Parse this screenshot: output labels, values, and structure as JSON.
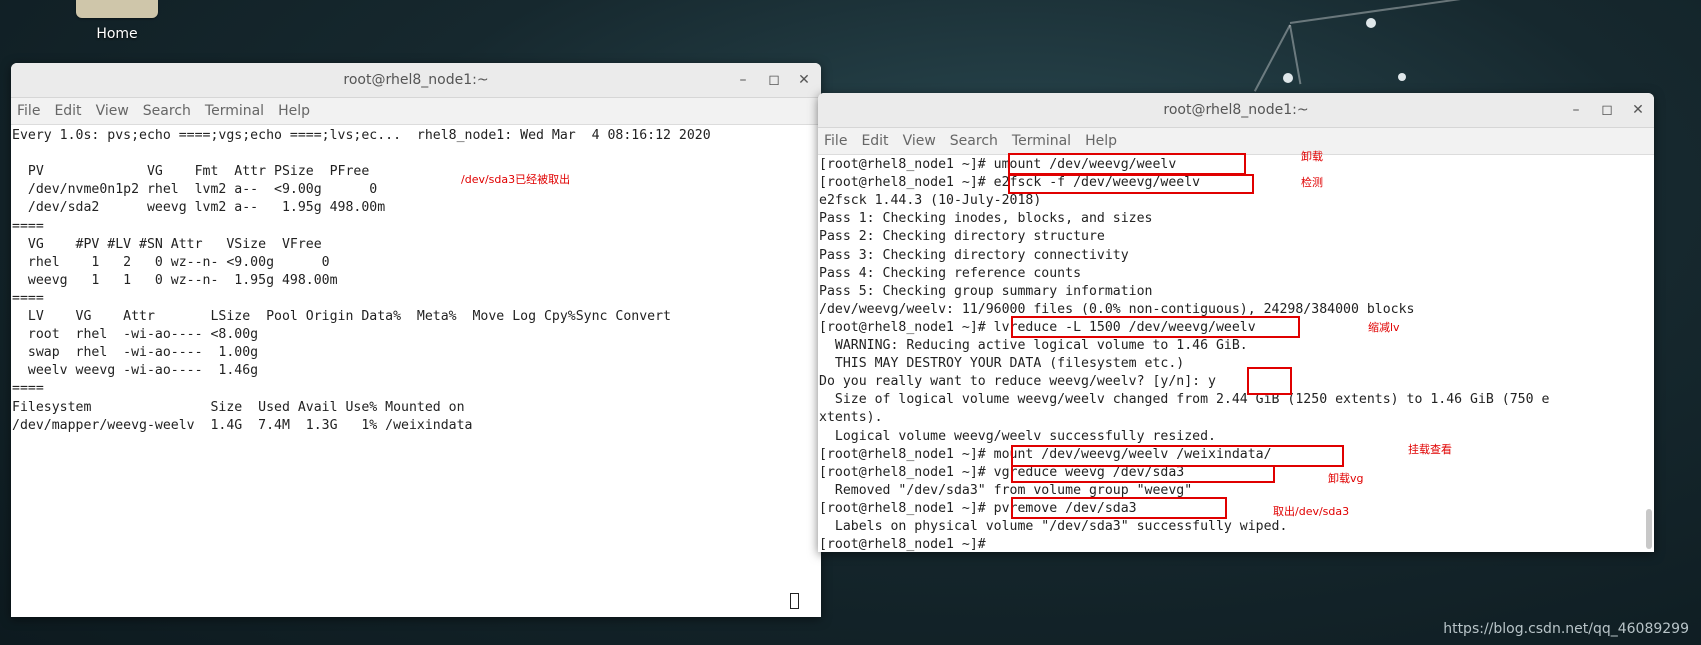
{
  "desktop": {
    "home_label": "Home",
    "watermark": "https://blog.csdn.net/qq_46089299"
  },
  "left_terminal": {
    "title": "root@rhel8_node1:~",
    "menu": [
      "File",
      "Edit",
      "View",
      "Search",
      "Terminal",
      "Help"
    ],
    "lines": [
      "Every 1.0s: pvs;echo ====;vgs;echo ====;lvs;ec...  rhel8_node1: Wed Mar  4 08:16:12 2020",
      "",
      "  PV             VG    Fmt  Attr PSize  PFree",
      "  /dev/nvme0n1p2 rhel  lvm2 a--  <9.00g      0",
      "  /dev/sda2      weevg lvm2 a--   1.95g 498.00m",
      "====",
      "  VG    #PV #LV #SN Attr   VSize  VFree",
      "  rhel    1   2   0 wz--n- <9.00g      0",
      "  weevg   1   1   0 wz--n-  1.95g 498.00m",
      "====",
      "  LV    VG    Attr       LSize  Pool Origin Data%  Meta%  Move Log Cpy%Sync Convert",
      "  root  rhel  -wi-ao---- <8.00g",
      "  swap  rhel  -wi-ao----  1.00g",
      "  weelv weevg -wi-ao----  1.46g",
      "====",
      "Filesystem               Size  Used Avail Use% Mounted on",
      "/dev/mapper/weevg-weelv  1.4G  7.4M  1.3G   1% /weixindata"
    ],
    "annotation": "/dev/sda3已经被取出"
  },
  "right_terminal": {
    "title": "root@rhel8_node1:~",
    "menu": [
      "File",
      "Edit",
      "View",
      "Search",
      "Terminal",
      "Help"
    ],
    "lines": [
      "[root@rhel8_node1 ~]# umount /dev/weevg/weelv",
      "[root@rhel8_node1 ~]# e2fsck -f /dev/weevg/weelv",
      "e2fsck 1.44.3 (10-July-2018)",
      "Pass 1: Checking inodes, blocks, and sizes",
      "Pass 2: Checking directory structure",
      "Pass 3: Checking directory connectivity",
      "Pass 4: Checking reference counts",
      "Pass 5: Checking group summary information",
      "/dev/weevg/weelv: 11/96000 files (0.0% non-contiguous), 24298/384000 blocks",
      "[root@rhel8_node1 ~]# lvreduce -L 1500 /dev/weevg/weelv",
      "  WARNING: Reducing active logical volume to 1.46 GiB.",
      "  THIS MAY DESTROY YOUR DATA (filesystem etc.)",
      "Do you really want to reduce weevg/weelv? [y/n]: y",
      "  Size of logical volume weevg/weelv changed from 2.44 GiB (1250 extents) to 1.46 GiB (750 e",
      "xtents).",
      "  Logical volume weevg/weelv successfully resized.",
      "[root@rhel8_node1 ~]# mount /dev/weevg/weelv /weixindata/",
      "[root@rhel8_node1 ~]# vgreduce weevg /dev/sda3",
      "  Removed \"/dev/sda3\" from volume group \"weevg\"",
      "[root@rhel8_node1 ~]# pvremove /dev/sda3",
      "  Labels on physical volume \"/dev/sda3\" successfully wiped.",
      "[root@rhel8_node1 ~]#"
    ],
    "annotations": [
      "卸载",
      "检测",
      "缩减lv",
      "挂载查看",
      "卸载vg",
      "取出/dev/sda3"
    ]
  }
}
